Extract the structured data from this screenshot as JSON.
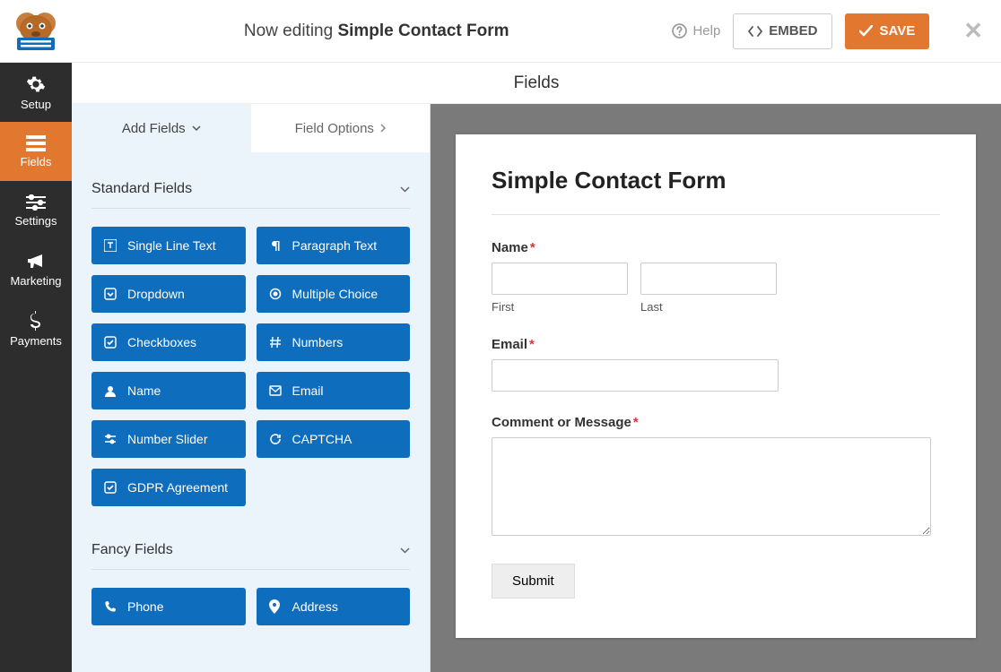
{
  "header": {
    "editing_prefix": "Now editing ",
    "form_name": "Simple Contact Form",
    "help": "Help",
    "embed": "EMBED",
    "save": "SAVE"
  },
  "sidebar": {
    "items": [
      {
        "label": "Setup",
        "icon": "gear"
      },
      {
        "label": "Fields",
        "icon": "list"
      },
      {
        "label": "Settings",
        "icon": "sliders"
      },
      {
        "label": "Marketing",
        "icon": "bullhorn"
      },
      {
        "label": "Payments",
        "icon": "dollar"
      }
    ]
  },
  "fields_header": "Fields",
  "panel": {
    "tabs": {
      "add": "Add Fields",
      "options": "Field Options"
    },
    "groups": [
      {
        "title": "Standard Fields",
        "items": [
          {
            "label": "Single Line Text",
            "icon": "text"
          },
          {
            "label": "Paragraph Text",
            "icon": "paragraph"
          },
          {
            "label": "Dropdown",
            "icon": "caret-sq"
          },
          {
            "label": "Multiple Choice",
            "icon": "radio"
          },
          {
            "label": "Checkboxes",
            "icon": "check-sq"
          },
          {
            "label": "Numbers",
            "icon": "hash"
          },
          {
            "label": "Name",
            "icon": "user"
          },
          {
            "label": "Email",
            "icon": "envelope"
          },
          {
            "label": "Number Slider",
            "icon": "sliders-h"
          },
          {
            "label": "CAPTCHA",
            "icon": "refresh"
          },
          {
            "label": "GDPR Agreement",
            "icon": "check-sq"
          }
        ]
      },
      {
        "title": "Fancy Fields",
        "items": [
          {
            "label": "Phone",
            "icon": "phone"
          },
          {
            "label": "Address",
            "icon": "marker"
          }
        ]
      }
    ]
  },
  "preview": {
    "title": "Simple Contact Form",
    "name_label": "Name",
    "first": "First",
    "last": "Last",
    "email_label": "Email",
    "comment_label": "Comment or Message",
    "submit": "Submit"
  }
}
